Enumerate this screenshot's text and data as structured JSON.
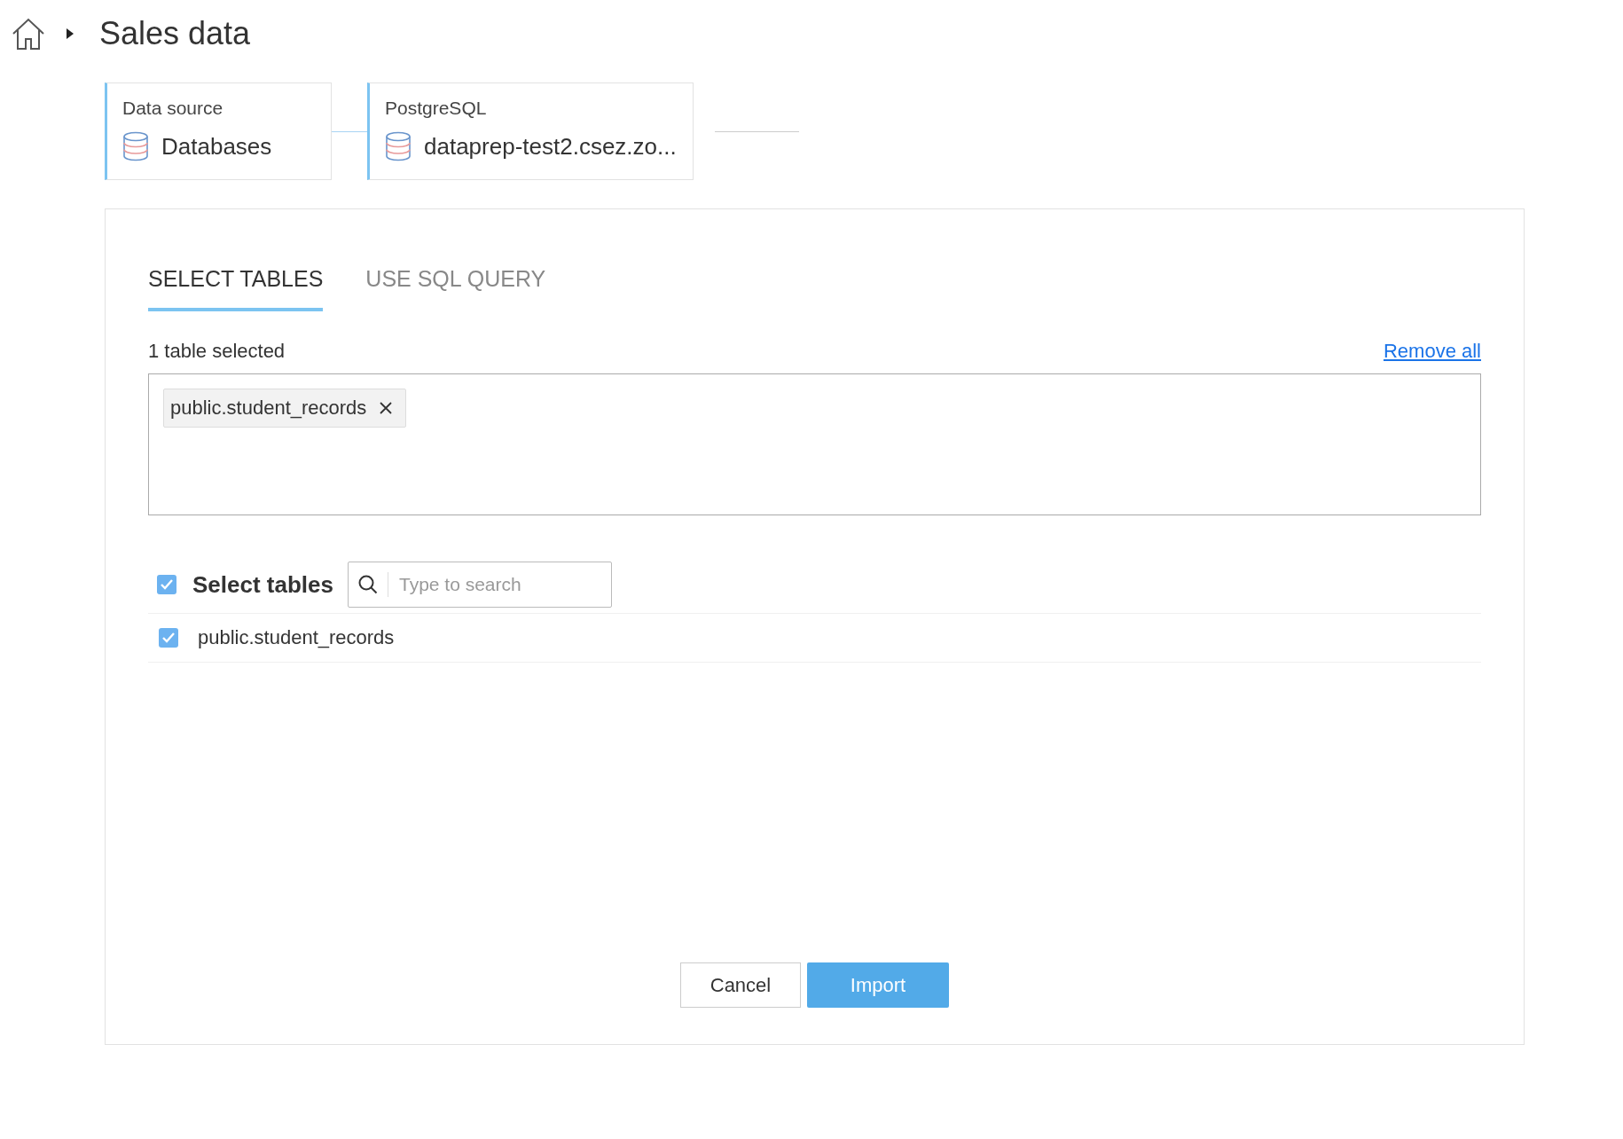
{
  "breadcrumb": {
    "title": "Sales data"
  },
  "steps": [
    {
      "label": "Data source",
      "value": "Databases"
    },
    {
      "label": "PostgreSQL",
      "value": "dataprep-test2.csez.zo..."
    }
  ],
  "tabs": [
    {
      "label": "SELECT TABLES",
      "selected": true
    },
    {
      "label": "USE SQL QUERY",
      "selected": false
    }
  ],
  "selection": {
    "count_text": "1 table selected",
    "remove_all": "Remove all",
    "chips": [
      "public.student_records"
    ]
  },
  "table_list": {
    "header": {
      "label": "Select tables",
      "checked": true
    },
    "search": {
      "placeholder": "Type to search"
    },
    "rows": [
      {
        "name": "public.student_records",
        "checked": true
      }
    ]
  },
  "buttons": {
    "cancel": "Cancel",
    "import": "Import"
  }
}
